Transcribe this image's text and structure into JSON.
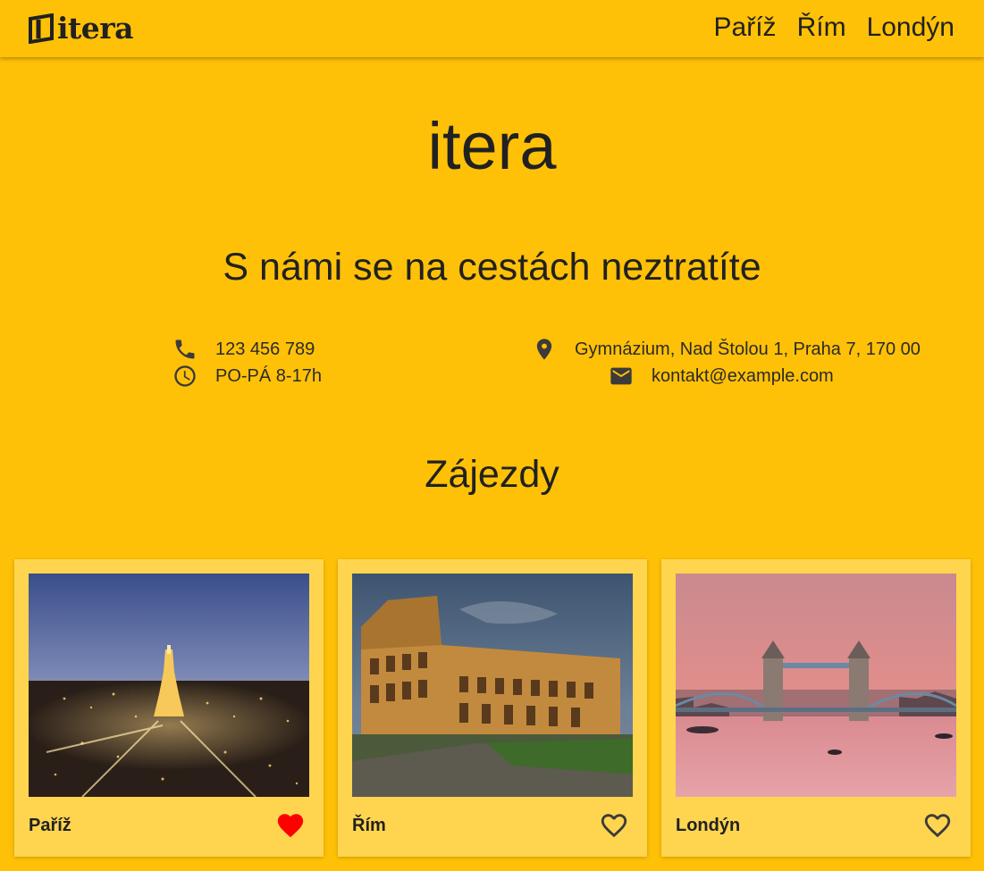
{
  "header": {
    "logo_text": "itera",
    "nav": [
      {
        "label": "Paříž"
      },
      {
        "label": "Řím"
      },
      {
        "label": "Londýn"
      }
    ]
  },
  "hero": {
    "title": "itera",
    "tagline": "S námi se na cestách neztratíte"
  },
  "contact": {
    "phone": {
      "icon": "phone-icon",
      "text": "123 456 789"
    },
    "hours": {
      "icon": "clock-icon",
      "text": "PO-PÁ 8-17h"
    },
    "address": {
      "icon": "location-pin-icon",
      "text": "Gymnázium, Nad Štolou 1, Praha 7, 170 00"
    },
    "email": {
      "icon": "mail-icon",
      "text": "kontakt@example.com"
    }
  },
  "trips": {
    "title": "Zájezdy",
    "cards": [
      {
        "name": "Paříž",
        "favorite": true
      },
      {
        "name": "Řím",
        "favorite": false
      },
      {
        "name": "Londýn",
        "favorite": false
      }
    ]
  },
  "colors": {
    "background": "#FFC107",
    "card": "#FFD54F",
    "text": "#212121",
    "favorite_active": "#FF0000"
  }
}
